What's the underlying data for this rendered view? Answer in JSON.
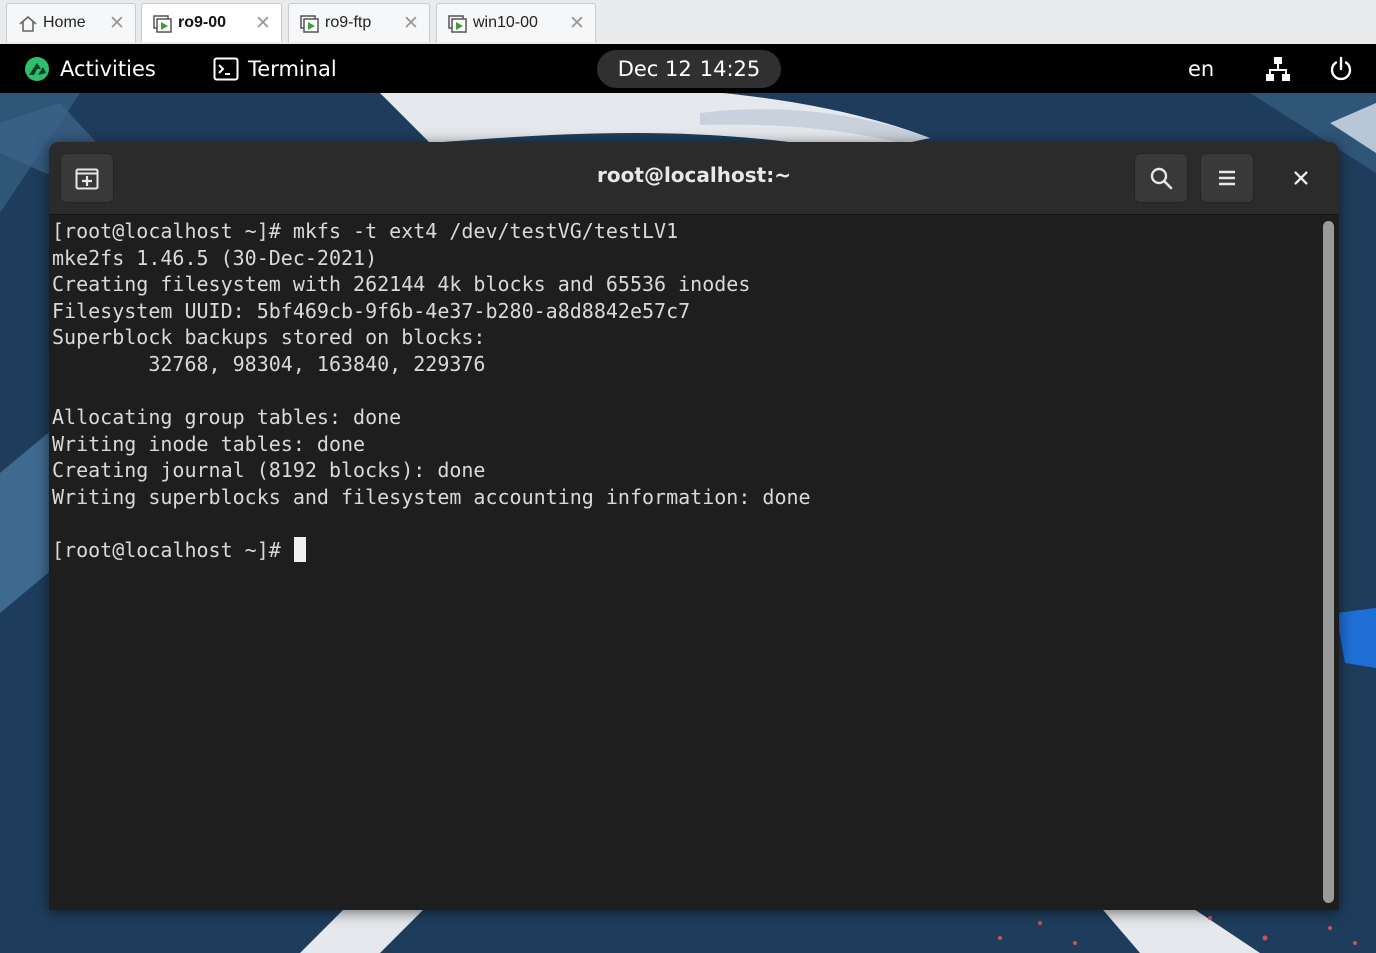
{
  "tabs": [
    {
      "label": "Home",
      "icon": "home-icon",
      "active": false
    },
    {
      "label": "ro9-00",
      "icon": "vm-icon",
      "active": true
    },
    {
      "label": "ro9-ftp",
      "icon": "vm-icon",
      "active": false
    },
    {
      "label": "win10-00",
      "icon": "vm-icon",
      "active": false
    }
  ],
  "tab_close_glyph": "✕",
  "topbar": {
    "activities": "Activities",
    "app_name": "Terminal",
    "date": "Dec 12",
    "time": "14:25",
    "language": "en"
  },
  "terminal_window": {
    "title": "root@localhost:~",
    "new_tab_icon": "new-tab-icon",
    "search_icon": "search-icon",
    "menu_icon": "hamburger-menu-icon",
    "close_icon": "close-icon"
  },
  "terminal": {
    "lines": [
      "[root@localhost ~]# mkfs -t ext4 /dev/testVG/testLV1",
      "mke2fs 1.46.5 (30-Dec-2021)",
      "Creating filesystem with 262144 4k blocks and 65536 inodes",
      "Filesystem UUID: 5bf469cb-9f6b-4e37-b280-a8d8842e57c7",
      "Superblock backups stored on blocks:",
      "        32768, 98304, 163840, 229376",
      "",
      "Allocating group tables: done",
      "Writing inode tables: done",
      "Creating journal (8192 blocks): done",
      "Writing superblocks and filesystem accounting information: done",
      ""
    ],
    "prompt": "[root@localhost ~]# "
  },
  "colors": {
    "topbar_bg": "#000000",
    "terminal_bg": "#1e1e1e",
    "terminal_fg": "#d9d9d9",
    "headerbar_bg": "#2b2b2b",
    "activities_accent": "#2dbf6e",
    "wallpaper": "#1e3d5c"
  }
}
